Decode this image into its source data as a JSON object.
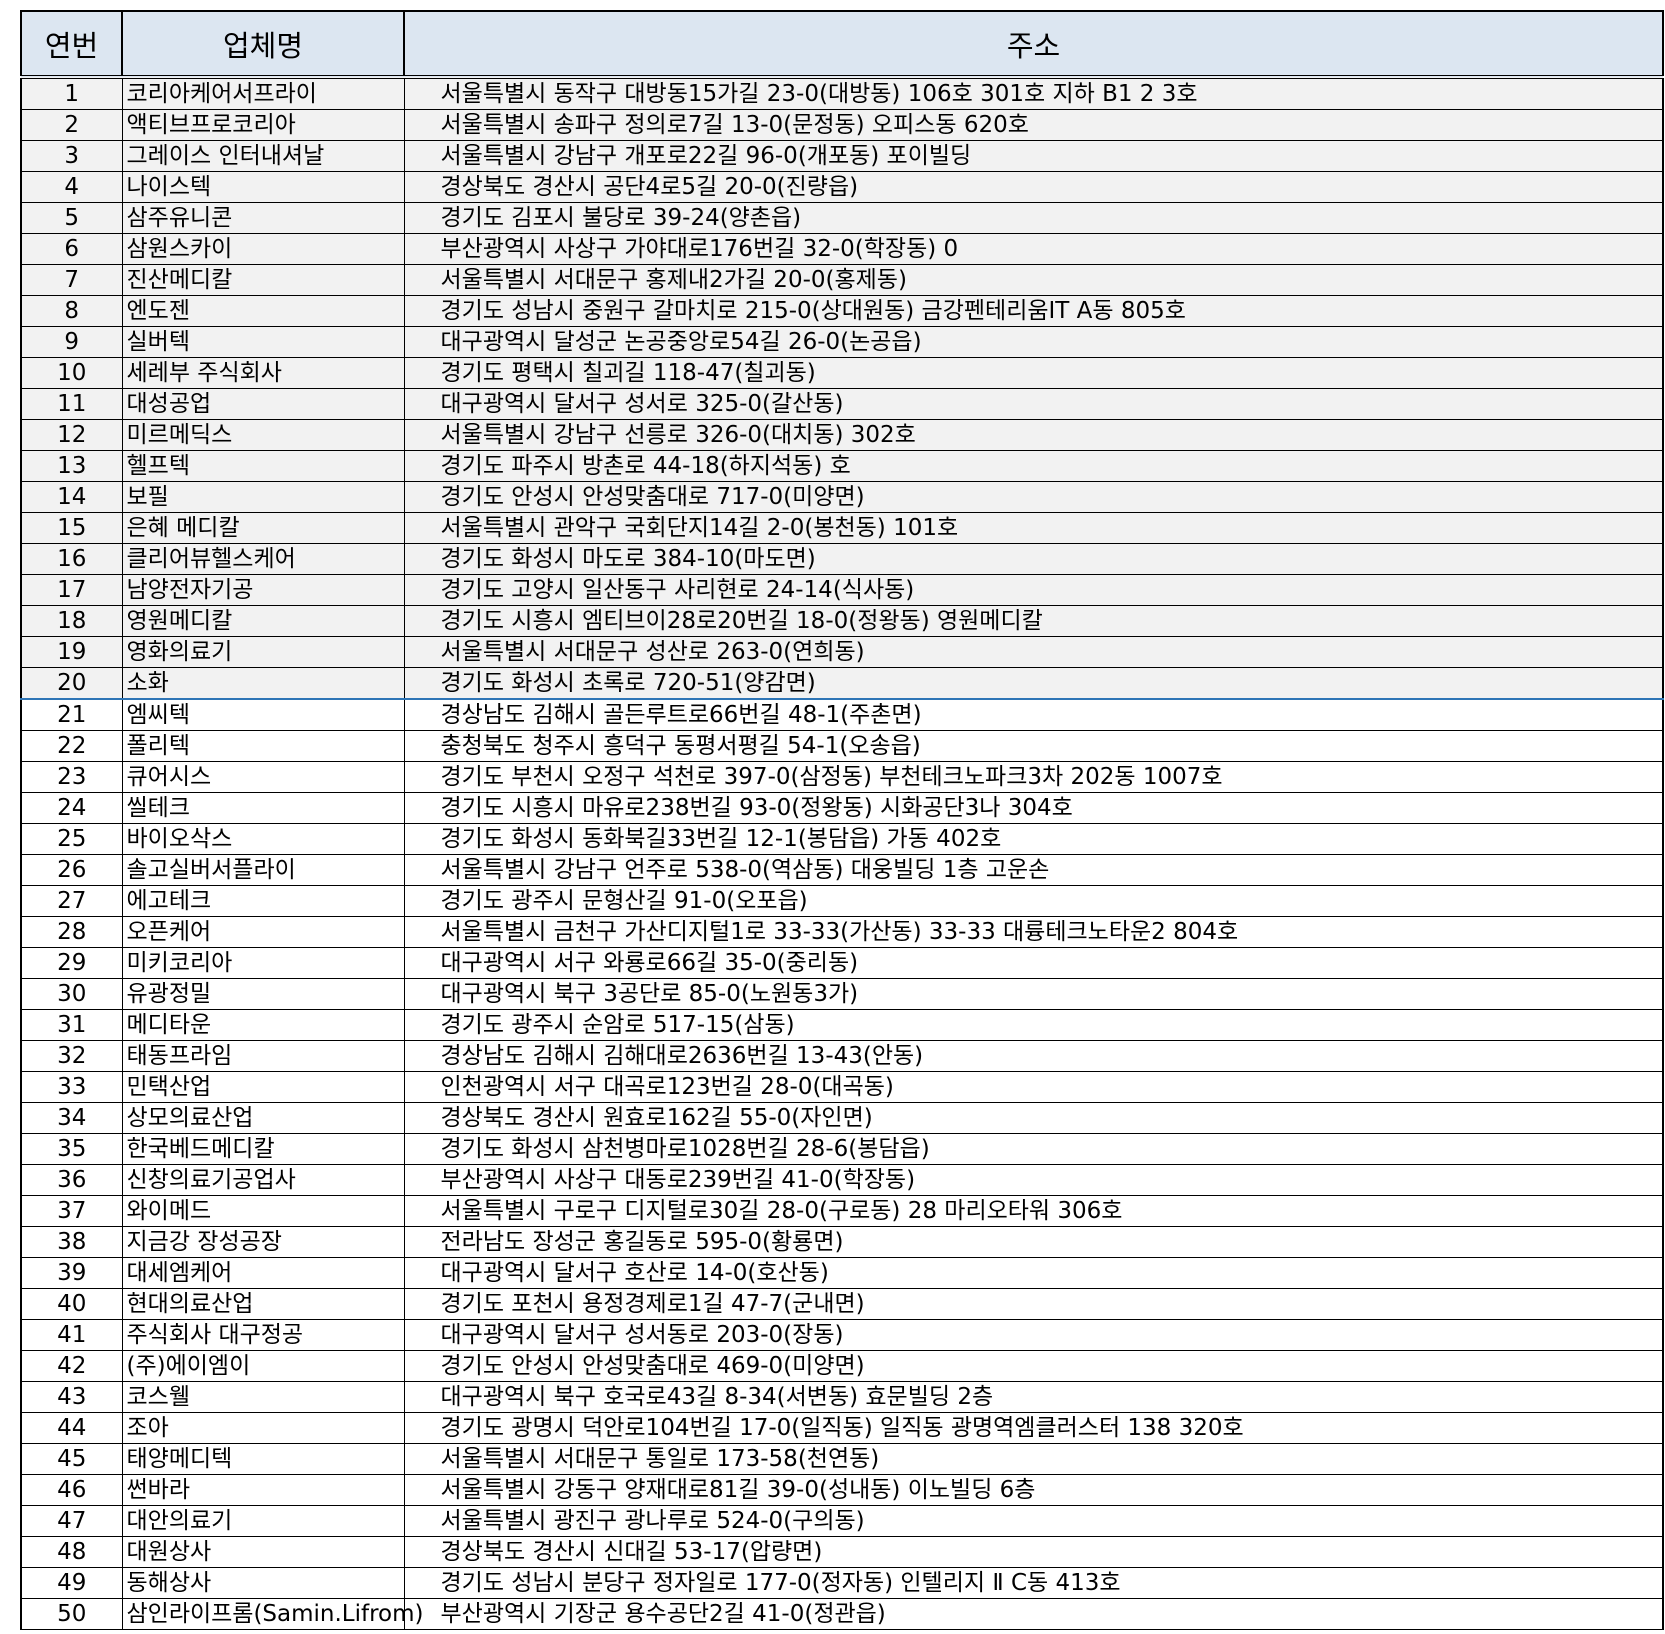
{
  "table": {
    "headers": {
      "no": "연번",
      "name": "업체명",
      "address": "주소"
    },
    "rows": [
      {
        "no": "1",
        "name": "코리아케어서프라이",
        "address": "서울특별시 동작구 대방동15가길 23-0(대방동) 106호 301호 지하 B1 2 3호"
      },
      {
        "no": "2",
        "name": "액티브프로코리아",
        "address": "서울특별시 송파구 정의로7길 13-0(문정동) 오피스동 620호"
      },
      {
        "no": "3",
        "name": "그레이스 인터내셔날",
        "address": "서울특별시 강남구 개포로22길 96-0(개포동) 포이빌딩"
      },
      {
        "no": "4",
        "name": "나이스텍",
        "address": "경상북도 경산시 공단4로5길 20-0(진량읍)"
      },
      {
        "no": "5",
        "name": "삼주유니콘",
        "address": "경기도 김포시 불당로 39-24(양촌읍)"
      },
      {
        "no": "6",
        "name": "삼원스카이",
        "address": "부산광역시 사상구 가야대로176번길 32-0(학장동) 0"
      },
      {
        "no": "7",
        "name": "진산메디칼",
        "address": "서울특별시 서대문구 홍제내2가길 20-0(홍제동)"
      },
      {
        "no": "8",
        "name": "엔도젠",
        "address": "경기도 성남시 중원구 갈마치로 215-0(상대원동) 금강펜테리움IT A동 805호"
      },
      {
        "no": "9",
        "name": "실버텍",
        "address": "대구광역시 달성군 논공중앙로54길 26-0(논공읍)"
      },
      {
        "no": "10",
        "name": "세레부 주식회사",
        "address": "경기도 평택시 칠괴길 118-47(칠괴동)"
      },
      {
        "no": "11",
        "name": "대성공업",
        "address": "대구광역시 달서구 성서로 325-0(갈산동)"
      },
      {
        "no": "12",
        "name": "미르메딕스",
        "address": "서울특별시 강남구 선릉로 326-0(대치동) 302호"
      },
      {
        "no": "13",
        "name": "헬프텍",
        "address": "경기도 파주시 방촌로 44-18(하지석동) 호"
      },
      {
        "no": "14",
        "name": "보필",
        "address": "경기도 안성시 안성맞춤대로 717-0(미양면)"
      },
      {
        "no": "15",
        "name": "은혜 메디칼",
        "address": "서울특별시 관악구 국회단지14길 2-0(봉천동) 101호"
      },
      {
        "no": "16",
        "name": "클리어뷰헬스케어",
        "address": "경기도 화성시 마도로 384-10(마도면)"
      },
      {
        "no": "17",
        "name": "남양전자기공",
        "address": "경기도 고양시 일산동구 사리현로 24-14(식사동)"
      },
      {
        "no": "18",
        "name": "영원메디칼",
        "address": "경기도 시흥시 엠티브이28로20번길 18-0(정왕동) 영원메디칼"
      },
      {
        "no": "19",
        "name": "영화의료기",
        "address": "서울특별시 서대문구 성산로 263-0(연희동)"
      },
      {
        "no": "20",
        "name": "소화",
        "address": "경기도 화성시 초록로 720-51(양감면)"
      },
      {
        "no": "21",
        "name": "엠씨텍",
        "address": "경상남도 김해시 골든루트로66번길 48-1(주촌면)"
      },
      {
        "no": "22",
        "name": "폴리텍",
        "address": "충청북도 청주시 흥덕구 동평서평길 54-1(오송읍)"
      },
      {
        "no": "23",
        "name": "큐어시스",
        "address": "경기도 부천시 오정구 석천로 397-0(삼정동) 부천테크노파크3차 202동 1007호"
      },
      {
        "no": "24",
        "name": "씰테크",
        "address": "경기도 시흥시 마유로238번길 93-0(정왕동) 시화공단3나 304호"
      },
      {
        "no": "25",
        "name": "바이오삭스",
        "address": "경기도 화성시 동화북길33번길 12-1(봉담읍) 가동 402호"
      },
      {
        "no": "26",
        "name": "솔고실버서플라이",
        "address": "서울특별시 강남구 언주로 538-0(역삼동) 대웅빌딩 1층 고운손"
      },
      {
        "no": "27",
        "name": "에고테크",
        "address": "경기도 광주시 문형산길 91-0(오포읍)"
      },
      {
        "no": "28",
        "name": "오픈케어",
        "address": "서울특별시 금천구 가산디지털1로 33-33(가산동) 33-33 대륭테크노타운2 804호"
      },
      {
        "no": "29",
        "name": "미키코리아",
        "address": "대구광역시 서구 와룡로66길 35-0(중리동)"
      },
      {
        "no": "30",
        "name": "유광정밀",
        "address": "대구광역시 북구 3공단로 85-0(노원동3가)"
      },
      {
        "no": "31",
        "name": "메디타운",
        "address": "경기도 광주시 순암로 517-15(삼동)"
      },
      {
        "no": "32",
        "name": "태동프라임",
        "address": "경상남도 김해시 김해대로2636번길 13-43(안동)"
      },
      {
        "no": "33",
        "name": "민택산업",
        "address": "인천광역시 서구 대곡로123번길 28-0(대곡동)"
      },
      {
        "no": "34",
        "name": "상모의료산업",
        "address": "경상북도 경산시 원효로162길 55-0(자인면)"
      },
      {
        "no": "35",
        "name": "한국베드메디칼",
        "address": "경기도 화성시 삼천병마로1028번길 28-6(봉담읍)"
      },
      {
        "no": "36",
        "name": "신창의료기공업사",
        "address": "부산광역시 사상구 대동로239번길 41-0(학장동)"
      },
      {
        "no": "37",
        "name": "와이메드",
        "address": "서울특별시 구로구 디지털로30길 28-0(구로동) 28 마리오타워 306호"
      },
      {
        "no": "38",
        "name": "지금강 장성공장",
        "address": "전라남도 장성군 홍길동로 595-0(황룡면)"
      },
      {
        "no": "39",
        "name": "대세엠케어",
        "address": "대구광역시 달서구 호산로 14-0(호산동)"
      },
      {
        "no": "40",
        "name": "현대의료산업",
        "address": "경기도 포천시 용정경제로1길 47-7(군내면)"
      },
      {
        "no": "41",
        "name": "주식회사 대구정공",
        "address": "대구광역시 달서구 성서동로 203-0(장동)"
      },
      {
        "no": "42",
        "name": "(주)에이엠이",
        "address": "경기도 안성시 안성맞춤대로 469-0(미양면)"
      },
      {
        "no": "43",
        "name": "코스웰",
        "address": "대구광역시 북구 호국로43길 8-34(서변동) 효문빌딩 2층"
      },
      {
        "no": "44",
        "name": "조아",
        "address": "경기도 광명시 덕안로104번길 17-0(일직동) 일직동 광명역엠클러스터 138 320호"
      },
      {
        "no": "45",
        "name": "태양메디텍",
        "address": "서울특별시 서대문구 통일로 173-58(천연동)"
      },
      {
        "no": "46",
        "name": "썬바라",
        "address": "서울특별시 강동구 양재대로81길 39-0(성내동) 이노빌딩 6층"
      },
      {
        "no": "47",
        "name": "대안의료기",
        "address": "서울특별시 광진구 광나루로 524-0(구의동)"
      },
      {
        "no": "48",
        "name": "대원상사",
        "address": "경상북도 경산시 신대길 53-17(압량면)"
      },
      {
        "no": "49",
        "name": "동해상사",
        "address": "경기도 성남시 분당구 정자일로 177-0(정자동) 인텔리지 Ⅱ C동 413호"
      },
      {
        "no": "50",
        "name": "삼인라이프롬(Samin.Lifrom)",
        "address": "부산광역시 기장군 용수공단2길 41-0(정관읍)"
      }
    ]
  }
}
